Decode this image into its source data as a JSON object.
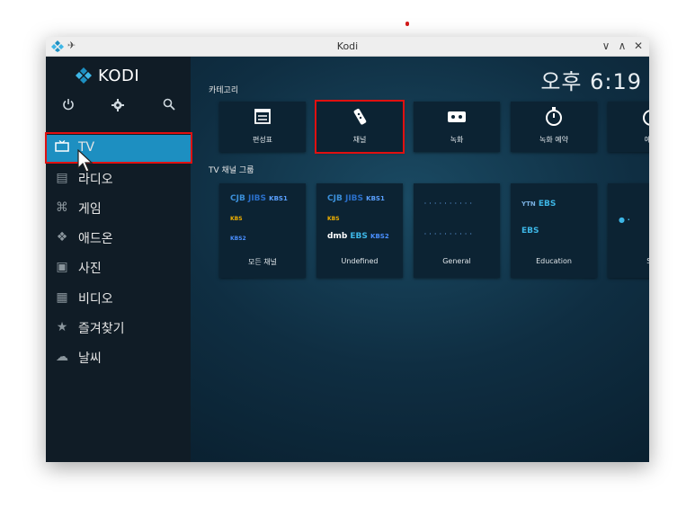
{
  "window": {
    "title": "Kodi",
    "pin_glyph": "✈",
    "controls": [
      "∨",
      "∧",
      "✕"
    ]
  },
  "app": {
    "logo_text": "KODI",
    "clock": "오후 6:19",
    "top_buttons": [
      {
        "icon": "power-icon",
        "glyph": "⏻"
      },
      {
        "icon": "settings-gear-icon",
        "glyph": "⚙"
      },
      {
        "icon": "search-icon",
        "glyph": "🔍"
      }
    ],
    "menu": [
      {
        "label": "TV",
        "icon": "tv-icon",
        "glyph": "▭",
        "active": true
      },
      {
        "label": "라디오",
        "icon": "radio-icon",
        "glyph": "▤"
      },
      {
        "label": "게임",
        "icon": "gamepad-icon",
        "glyph": "⌘"
      },
      {
        "label": "애드온",
        "icon": "addon-box-icon",
        "glyph": "❖"
      },
      {
        "label": "사진",
        "icon": "picture-icon",
        "glyph": "▣"
      },
      {
        "label": "비디오",
        "icon": "film-icon",
        "glyph": "▦"
      },
      {
        "label": "즐겨찾기",
        "icon": "star-icon",
        "glyph": "★"
      },
      {
        "label": "날씨",
        "icon": "weather-icon",
        "glyph": "☁"
      }
    ]
  },
  "categories": {
    "heading": "카테고리",
    "items": [
      {
        "label": "편성표",
        "icon": "guide-calendar-icon"
      },
      {
        "label": "채널",
        "icon": "remote-control-icon"
      },
      {
        "label": "녹화",
        "icon": "tape-icon"
      },
      {
        "label": "녹화 예약",
        "icon": "timer-icon"
      },
      {
        "label": "예약",
        "icon": "timer-icon"
      }
    ]
  },
  "groups": {
    "heading": "TV 채널 그룹",
    "items": [
      {
        "label": "모든 채널"
      },
      {
        "label": "Undefined"
      },
      {
        "label": "General"
      },
      {
        "label": "Education"
      },
      {
        "label": "Sc"
      }
    ],
    "logos": {
      "cjb": "CJB",
      "jibs": "JIBS",
      "kbs1": "KBS1",
      "kbs2": "KBS2",
      "kbs": "KBS",
      "ytn": "YTN",
      "dmb": "dmb",
      "ebs": "EBS"
    }
  },
  "colors": {
    "accent": "#1d8fc1",
    "highlight_box": "#e01010"
  }
}
